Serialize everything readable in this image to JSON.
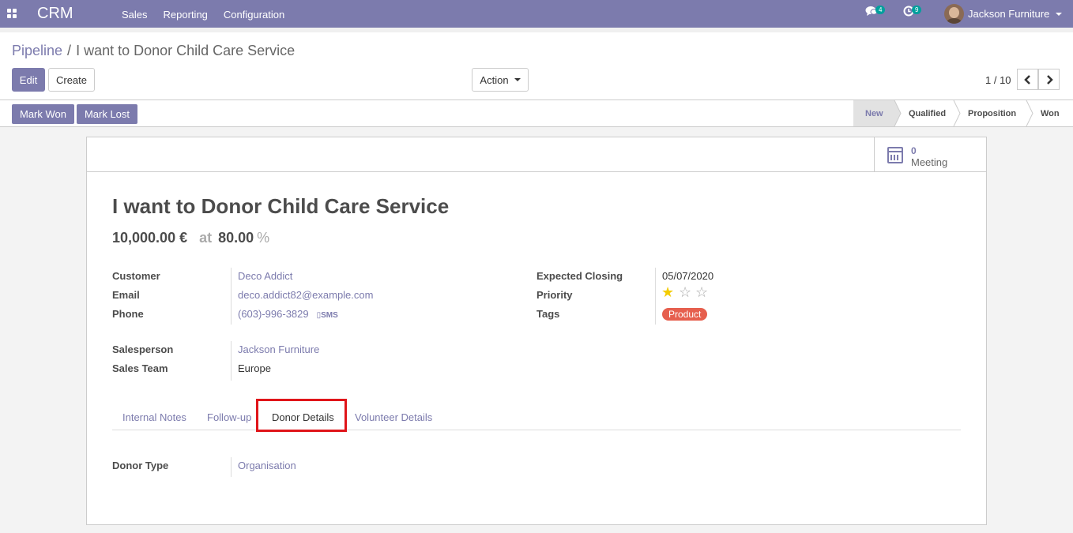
{
  "navbar": {
    "app_name": "CRM",
    "menu": [
      "Sales",
      "Reporting",
      "Configuration"
    ],
    "messages_count": "4",
    "activities_count": "9",
    "user_name": "Jackson Furniture"
  },
  "breadcrumb": {
    "parent": "Pipeline",
    "separator": "/",
    "current": "I want to Donor Child Care Service"
  },
  "toolbar": {
    "edit_label": "Edit",
    "create_label": "Create",
    "action_label": "Action",
    "pager": "1 / 10"
  },
  "statusbar": {
    "mark_won": "Mark Won",
    "mark_lost": "Mark Lost",
    "stages": [
      "New",
      "Qualified",
      "Proposition",
      "Won"
    ],
    "active_stage": "New"
  },
  "smart_button": {
    "count": "0",
    "label": "Meeting"
  },
  "record": {
    "title": "I want to Donor Child Care Service",
    "revenue": "10,000.00 €",
    "at_label": "at",
    "probability": "80.00",
    "percent_sign": "%",
    "fields_left": [
      {
        "label": "Customer",
        "value": "Deco Addict"
      },
      {
        "label": "Email",
        "value": "deco.addict82@example.com"
      },
      {
        "label": "Phone",
        "value": "(603)-996-3829"
      }
    ],
    "sms_label": "SMS",
    "fields_left2": [
      {
        "label": "Salesperson",
        "value": "Jackson Furniture"
      },
      {
        "label": "Sales Team",
        "value": "Europe"
      }
    ],
    "fields_right": [
      {
        "label": "Expected Closing",
        "value": "05/07/2020"
      },
      {
        "label": "Priority",
        "value": "1 of 3 stars"
      },
      {
        "label": "Tags",
        "value": "Product"
      }
    ]
  },
  "tabs": [
    "Internal Notes",
    "Follow-up",
    "Donor Details",
    "Volunteer Details"
  ],
  "active_tab": "Donor Details",
  "donor": {
    "label": "Donor Type",
    "value": "Organisation"
  },
  "colors": {
    "brand": "#7c7bad",
    "tag": "#e65f4e",
    "highlight": "#e0151a",
    "badge": "#00a09d",
    "star": "#f3cc00"
  }
}
